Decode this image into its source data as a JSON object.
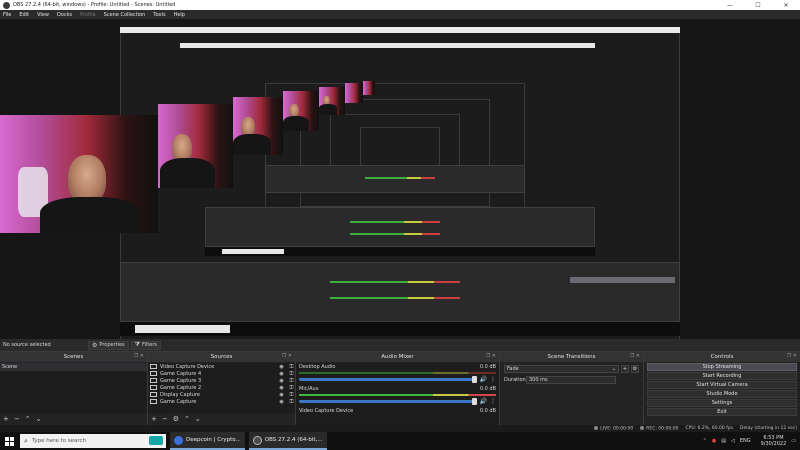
{
  "window": {
    "title": "OBS 27.2.4 (64-bit, windows) - Profile: Untitled - Scenes: Untitled",
    "minimize": "—",
    "maximize": "☐",
    "close": "✕"
  },
  "menu": {
    "items": [
      "File",
      "Edit",
      "View",
      "Docks",
      "Profile",
      "Scene Collection",
      "Tools",
      "Help"
    ]
  },
  "status_strip": {
    "no_source": "No source selected",
    "properties": "Properties",
    "filters": "Filters"
  },
  "scenes": {
    "header": "Scenes",
    "items": [
      "Scene"
    ]
  },
  "sources": {
    "header": "Sources",
    "items": [
      "Video Capture Device",
      "Game Capture 4",
      "Game Capture 3",
      "Game Capture 2",
      "Display Capture",
      "Game Capture"
    ]
  },
  "mixer": {
    "header": "Audio Mixer",
    "channels": [
      {
        "name": "Desktop Audio",
        "db": "0.0 dB"
      },
      {
        "name": "Mic/Aux",
        "db": "0.0 dB"
      },
      {
        "name": "Video Capture Device",
        "db": "0.0 dB"
      }
    ]
  },
  "transitions": {
    "header": "Scene Transitions",
    "type": "Fade",
    "duration_label": "Duration",
    "duration_value": "300 ms"
  },
  "controls": {
    "header": "Controls",
    "buttons": [
      "Stop Streaming",
      "Start Recording",
      "Start Virtual Camera",
      "Studio Mode",
      "Settings",
      "Exit"
    ]
  },
  "bottom_status": {
    "live": "LIVE: 00:00:00",
    "rec": "REC: 00:00:00",
    "cpu": "CPU: 6.2%, 60.00 fps",
    "delay": "Delay (starting in 12 sec)"
  },
  "taskbar": {
    "search_placeholder": "Type here to search",
    "apps": [
      {
        "label": "Deepcoin | Crypto...",
        "color": "#3b6fd9"
      },
      {
        "label": "OBS 27.2.4 (64-bit,...",
        "color": "#3a3a3a"
      }
    ],
    "lang": "ENG",
    "time": "6:53 PM",
    "date": "9/30/2022"
  },
  "colors": {
    "accent_slider": "#3a78c8",
    "selected_control": "#4a4a52"
  }
}
